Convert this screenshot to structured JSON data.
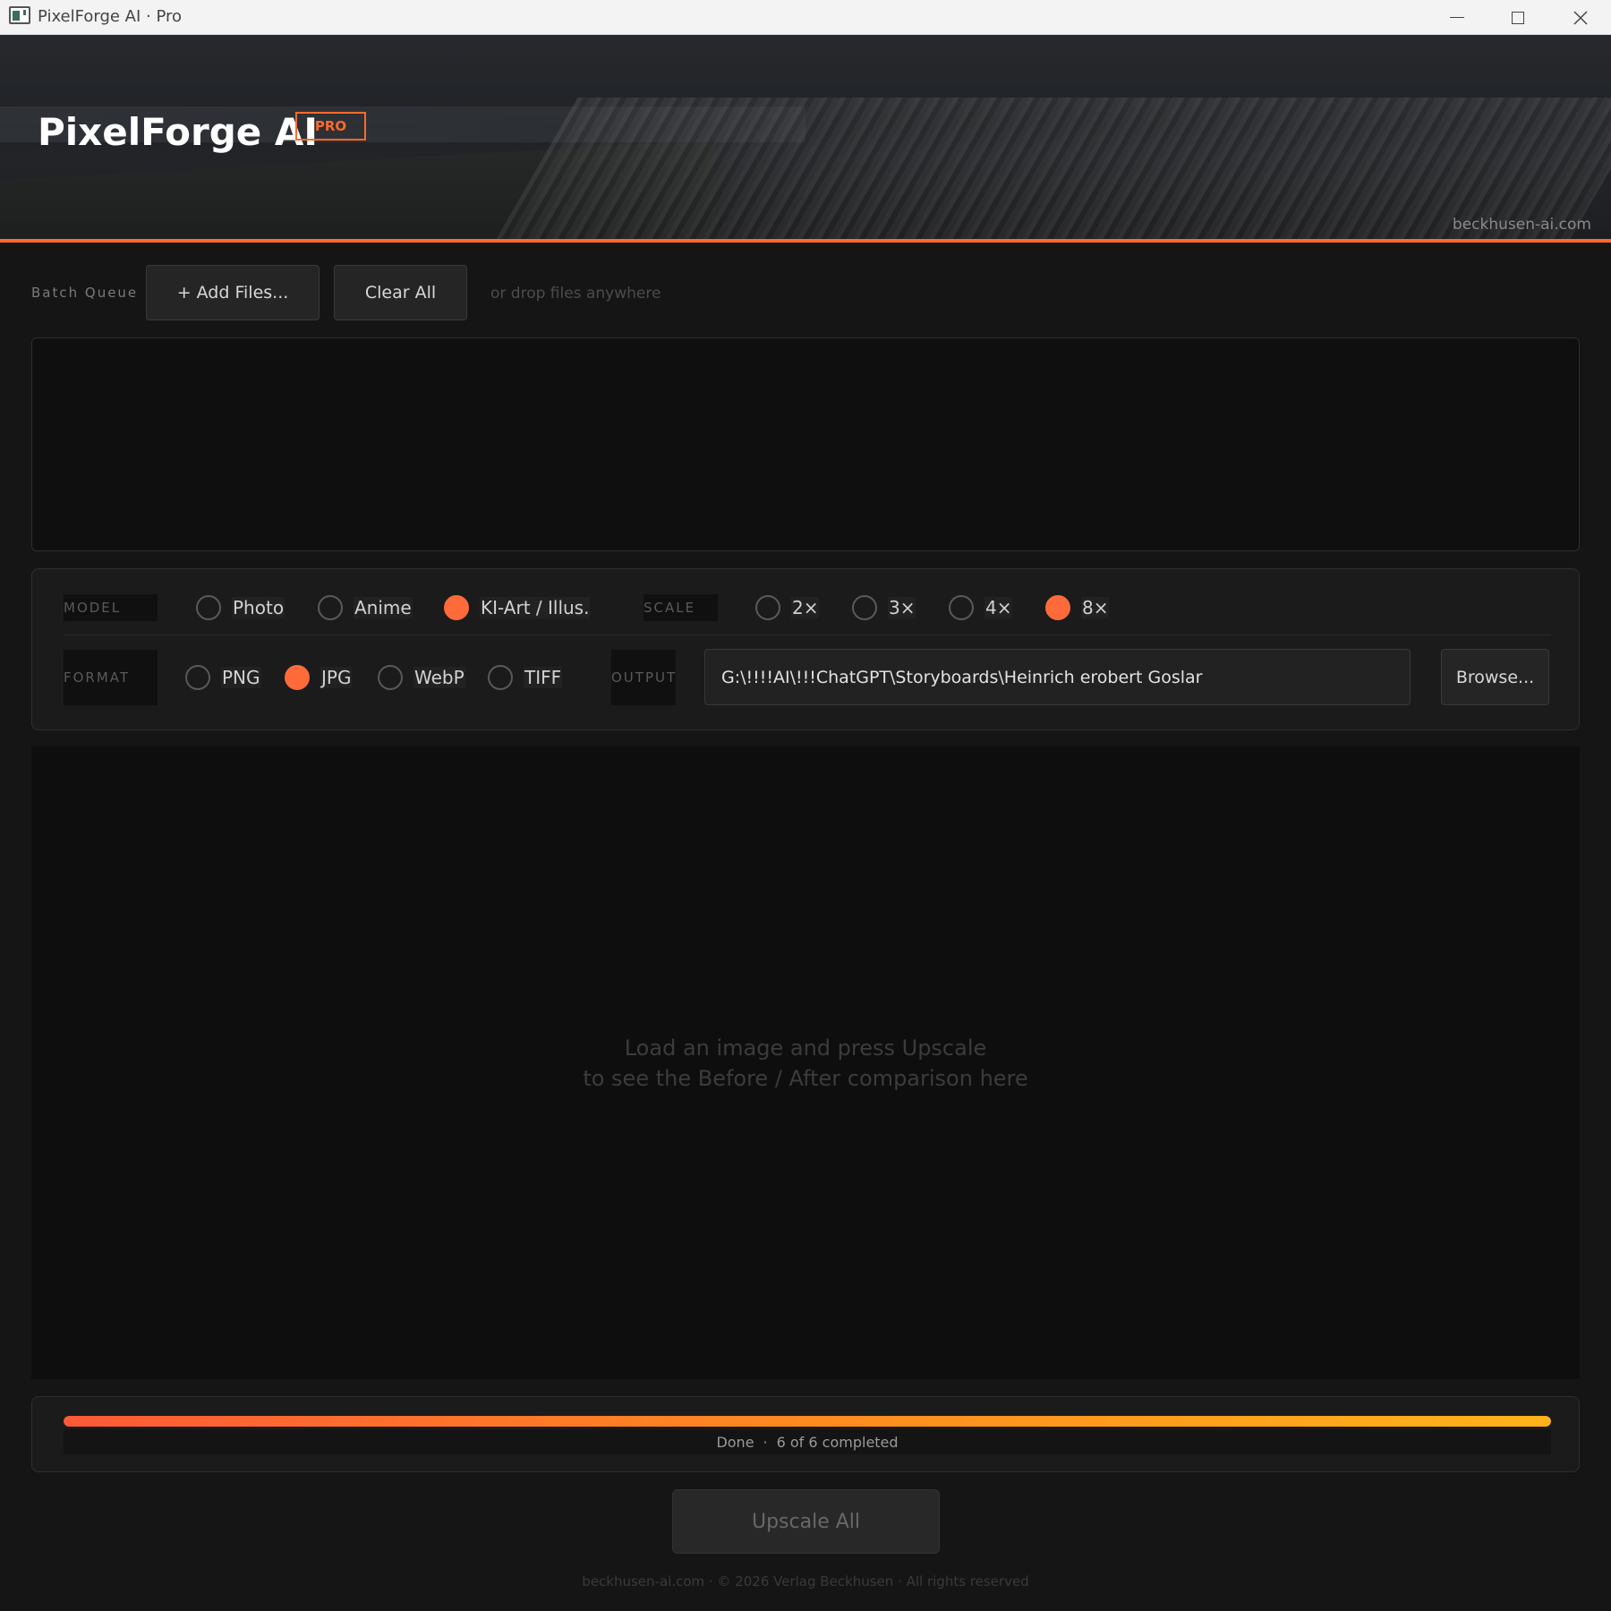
{
  "window": {
    "title": "PixelForge AI · Pro"
  },
  "header": {
    "brand": "PixelForge AI",
    "badge": "PRO",
    "site": "beckhusen-ai.com"
  },
  "batch": {
    "label": "Batch Queue",
    "add_label": "+ Add Files...",
    "clear_label": "Clear All",
    "drop_hint": "or drop files anywhere"
  },
  "settings": {
    "model_label": "MODEL",
    "models": [
      "Photo",
      "Anime",
      "KI-Art / Illus."
    ],
    "model_selected": "KI-Art / Illus.",
    "scale_label": "SCALE",
    "scales": [
      "2×",
      "3×",
      "4×",
      "8×"
    ],
    "scale_selected": "8×",
    "format_label": "FORMAT",
    "formats": [
      "PNG",
      "JPG",
      "WebP",
      "TIFF"
    ],
    "format_selected": "JPG",
    "output_label": "OUTPUT",
    "output_path": "G:\\!!!!AI\\!!!ChatGPT\\Storyboards\\Heinrich erobert Goslar",
    "browse_label": "Browse..."
  },
  "preview": {
    "line1": "Load an image and press Upscale",
    "line2": "to see the Before / After comparison here"
  },
  "progress": {
    "percent": 100,
    "status": "Done",
    "separator": "·",
    "detail": "6 of 6 completed"
  },
  "actions": {
    "upscale_label": "Upscale All"
  },
  "footer": {
    "text": "beckhusen-ai.com  ·  © 2026 Verlag Beckhusen  ·  All rights reserved"
  },
  "colors": {
    "accent": "#ff6a2b",
    "radio_on": "#ff6a3a",
    "progress_end": "#ffb31a"
  }
}
